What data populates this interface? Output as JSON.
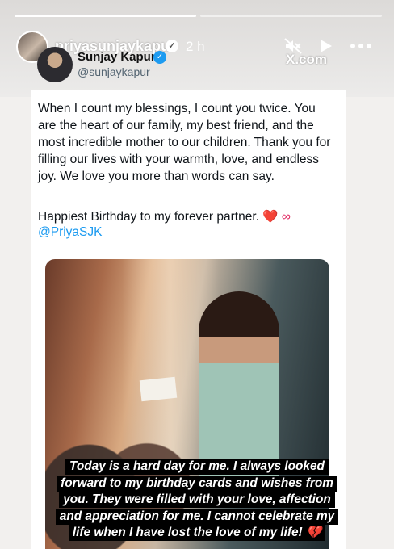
{
  "story": {
    "username": "priyasunjaykapur",
    "time": "2 h",
    "progress": [
      1.0,
      0.0
    ]
  },
  "watermark": "X.com",
  "tweet": {
    "author_name": "Sunjay Kapur",
    "author_handle": "@sunjaykapur",
    "body": "When I count my blessings, I count you twice. You are the heart of our family, my best friend, and the most incredible mother to our children. Thank you for filling our lives with your warmth, love, and endless joy. We love you more than words can say.",
    "line2": "Happiest Birthday to my forever partner. ",
    "line2_emoji": "❤️ ∞",
    "mention": "@PriyaSJK"
  },
  "caption": {
    "lines": [
      "Today is a hard day for me. I always looked",
      "forward to my birthday cards and wishes from",
      "you. They were filled with your love, affection",
      "and appreciation for me. I cannot celebrate my",
      "life when I have lost the love of my life!"
    ],
    "end_emoji": "💔"
  },
  "icons": {
    "mute": "mute-icon",
    "play": "play-icon",
    "more": "more-icon",
    "verified": "verified-icon"
  },
  "colors": {
    "link": "#1d9bf0",
    "caption_bg": "#000000"
  }
}
